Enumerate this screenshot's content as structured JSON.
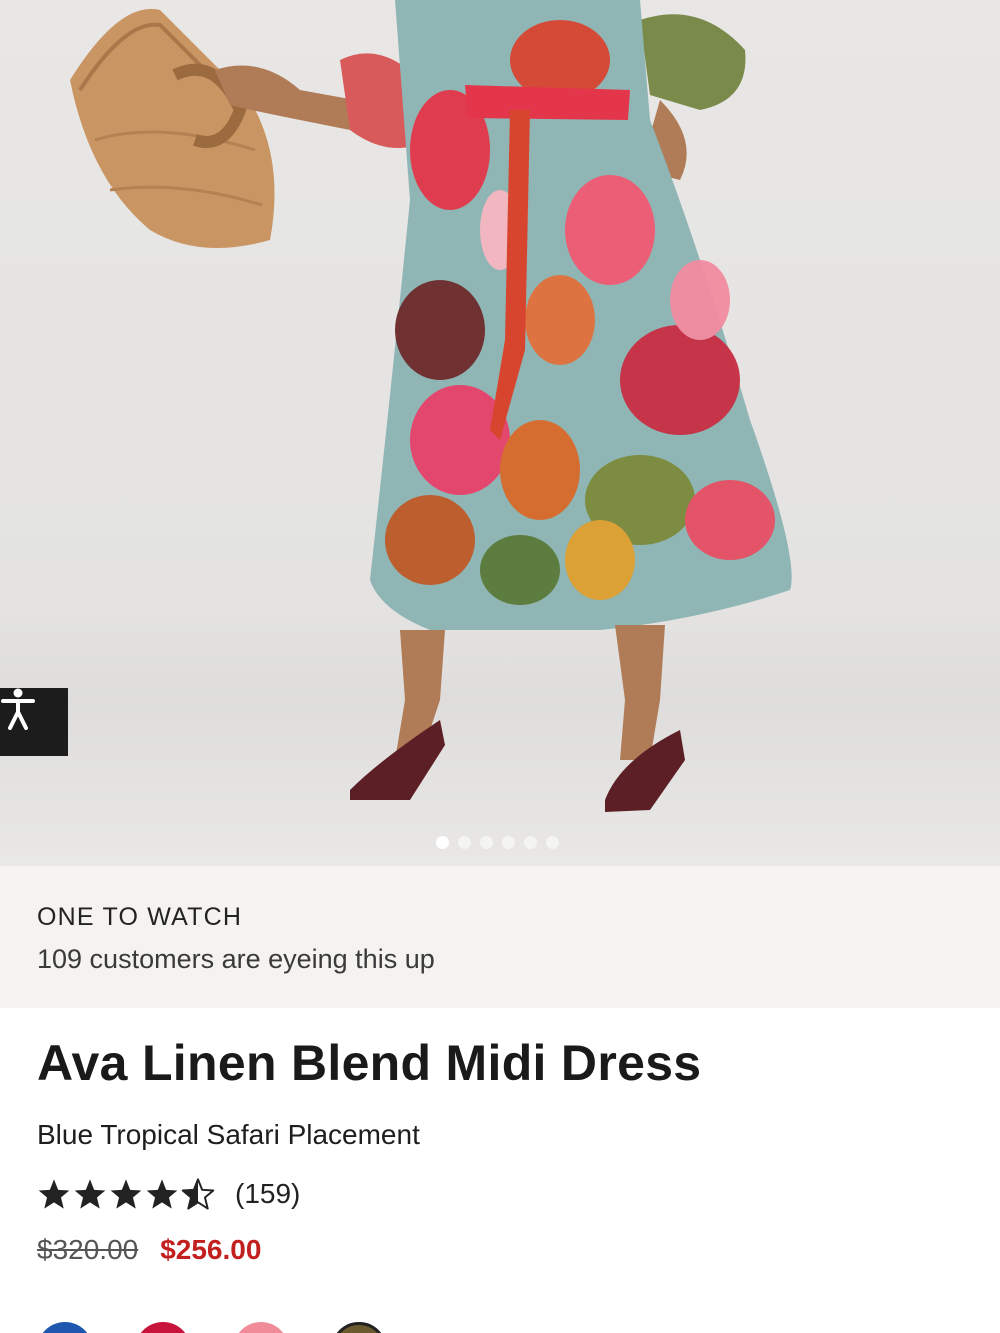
{
  "gallery": {
    "image_alt": "Model wearing the Ava Linen Blend Midi Dress in a tropical safari print, holding a woven fan-shaped bag",
    "slide_count": 6,
    "active_slide": 1
  },
  "accessibility": {
    "icon": "accessibility-person-icon"
  },
  "watch_banner": {
    "title": "ONE TO WATCH",
    "subtitle": "109 customers are eyeing this up"
  },
  "product": {
    "name": "Ava Linen Blend Midi Dress",
    "variant": "Blue Tropical Safari Placement",
    "rating_value": 4.5,
    "rating_max": 5,
    "review_count": "(159)",
    "original_price": "$320.00",
    "sale_price": "$256.00"
  },
  "colors": {
    "sale": "#c21f1f",
    "banner_bg": "#f5f3ef",
    "swatches": [
      "#1e56b0",
      "#c8143c",
      "#f08c9a",
      "#6b5a2e"
    ]
  }
}
